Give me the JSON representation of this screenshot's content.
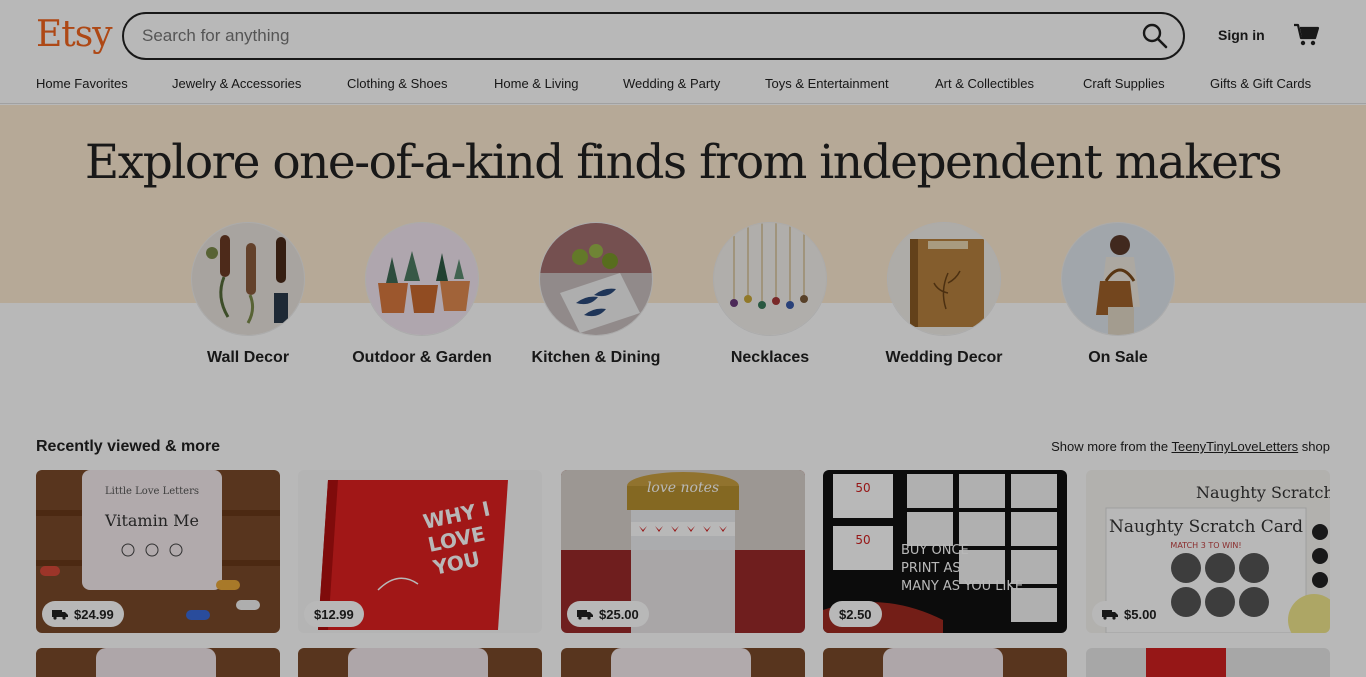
{
  "brand": {
    "logo": "Etsy",
    "accent": "#f1641e"
  },
  "search": {
    "placeholder": "Search for anything",
    "value": "",
    "icon": "search-icon"
  },
  "header": {
    "signin": "Sign in",
    "cart_icon": "shopping-cart-icon"
  },
  "nav": [
    "Home Favorites",
    "Jewelry & Accessories",
    "Clothing & Shoes",
    "Home & Living",
    "Wedding & Party",
    "Toys & Entertainment",
    "Art & Collectibles",
    "Craft Supplies",
    "Gifts & Gift Cards"
  ],
  "hero": {
    "title": "Explore one-of-a-kind finds from independent makers",
    "categories": [
      {
        "label": "Wall Decor"
      },
      {
        "label": "Outdoor & Garden"
      },
      {
        "label": "Kitchen & Dining"
      },
      {
        "label": "Necklaces"
      },
      {
        "label": "Wedding Decor"
      },
      {
        "label": "On Sale"
      }
    ]
  },
  "recent": {
    "title": "Recently viewed & more",
    "more_prefix": "Show more from the ",
    "more_shop": "TeenyTinyLoveLetters",
    "more_suffix": " shop",
    "items": [
      {
        "price": "$24.99",
        "free_shipping": true,
        "image_text": [
          "Little Love Letters",
          "Vitamin Me"
        ]
      },
      {
        "price": "$12.99",
        "free_shipping": false,
        "image_text": [
          "WHY I LOVE YOU"
        ]
      },
      {
        "price": "$25.00",
        "free_shipping": true,
        "image_text": [
          "love notes"
        ]
      },
      {
        "price": "$2.50",
        "free_shipping": false,
        "image_text": [
          "BUY ONCE PRINT AS MANY AS YOU LIKE"
        ]
      },
      {
        "price": "$5.00",
        "free_shipping": true,
        "image_text": [
          "Naughty Scratch Card",
          "MATCH 3 TO WIN!"
        ]
      }
    ]
  }
}
